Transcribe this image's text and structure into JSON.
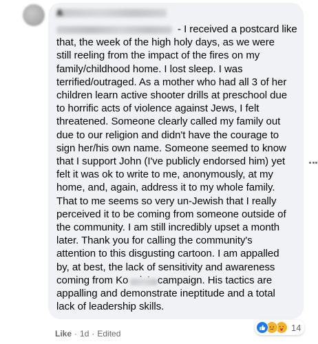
{
  "comment": {
    "author_initial": "A",
    "text": "- I received a postcard like\nthat, the week of the high holy days, as we were\nstill reeling from the impact of the fires on my\nfamily/childhood home. I lost sleep. I was\nterrified/outraged. As a mother who had all 3 of her\nchildren learn active shooter drills at preschool due\nto horrific acts of violence against Jews, I felt\nthreatened. Someone clearly called my family out\ndue to our religion and didn't have the courage to\nsign her/his own name. Someone seemed to know\nthat I support John (I've publicly endorsed him) yet\nfelt it was ok to write to me, anonymously, at my\nhome, and, again, address it to my whole family.\nThat to me seems so very un-Jewish that I really\nperceived it to be coming from someone outside of\nthe community. I am still incredibly upset a month\nlater. Thank you          for calling the community's\nattention to this disgusting cartoon. I am appalled\nby, at best, the lack of sensitivity and awareness\ncoming from Koenig's campaign. His tactics are\nappalling and demonstrate ineptitude and a total\nlack of leadership skills."
  },
  "reactions": {
    "icons": [
      "like-icon",
      "sad-icon",
      "care-icon"
    ],
    "count": "14"
  },
  "meta": {
    "like_label": "Like",
    "separator": "·",
    "time": "1d",
    "edited": "Edited"
  },
  "colors": {
    "bubble_bg": "#f0f2f5",
    "text": "#050505",
    "meta": "#65676b",
    "like_blue": "#1877f2",
    "emoji_yellow": "#f7b125"
  }
}
